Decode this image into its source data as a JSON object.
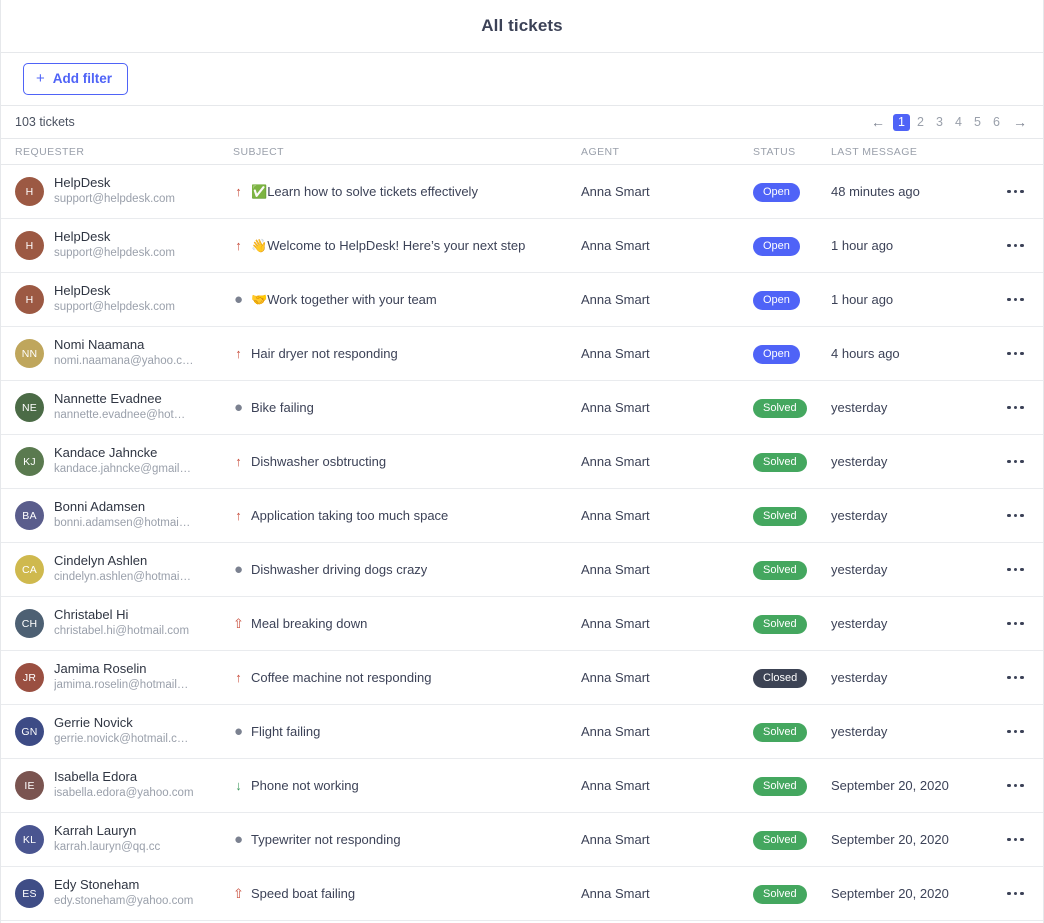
{
  "header": {
    "title": "All tickets"
  },
  "toolbar": {
    "add_filter_label": "Add filter",
    "plus_glyph": "+",
    "ticket_count": "103 tickets"
  },
  "pagination": {
    "prev_glyph": "←",
    "next_glyph": "→",
    "pages": [
      "1",
      "2",
      "3",
      "4",
      "5",
      "6"
    ],
    "active_page": "1",
    "active_color": "#4f63f7"
  },
  "columns": {
    "requester": "REQUESTER",
    "subject": "SUBJECT",
    "agent": "AGENT",
    "status": "STATUS",
    "last_message": "LAST MESSAGE"
  },
  "status_colors": {
    "Open": "#4f63f7",
    "Solved": "#44a75f",
    "Closed": "#3c4354"
  },
  "priority_glyphs": {
    "urgent": "⇧",
    "high": "↑",
    "normal": "●",
    "low": "↓"
  },
  "rows": [
    {
      "initials": "H",
      "avatar_color": "#9c5943",
      "name": "HelpDesk",
      "email": "support@helpdesk.com",
      "priority": "high",
      "emoji": "✅",
      "subject": "Learn how to solve tickets effectively",
      "agent": "Anna Smart",
      "status": "Open",
      "last_message": "48 minutes ago"
    },
    {
      "initials": "H",
      "avatar_color": "#9c5943",
      "name": "HelpDesk",
      "email": "support@helpdesk.com",
      "priority": "high",
      "emoji": "👋",
      "subject": "Welcome to HelpDesk! Here’s your next step",
      "agent": "Anna Smart",
      "status": "Open",
      "last_message": "1 hour ago"
    },
    {
      "initials": "H",
      "avatar_color": "#9c5943",
      "name": "HelpDesk",
      "email": "support@helpdesk.com",
      "priority": "normal",
      "emoji": "🤝",
      "subject": "Work together with your team",
      "agent": "Anna Smart",
      "status": "Open",
      "last_message": "1 hour ago"
    },
    {
      "initials": "NN",
      "avatar_color": "#bfa65c",
      "name": "Nomi Naamana",
      "email": "nomi.naamana@yahoo.c…",
      "priority": "high",
      "emoji": "",
      "subject": "Hair dryer not responding",
      "agent": "Anna Smart",
      "status": "Open",
      "last_message": "4 hours ago"
    },
    {
      "initials": "NE",
      "avatar_color": "#4b6b46",
      "name": "Nannette Evadnee",
      "email": "nannette.evadnee@hot…",
      "priority": "normal",
      "emoji": "",
      "subject": "Bike failing",
      "agent": "Anna Smart",
      "status": "Solved",
      "last_message": "yesterday"
    },
    {
      "initials": "KJ",
      "avatar_color": "#5a7a4f",
      "name": "Kandace Jahncke",
      "email": "kandace.jahncke@gmail…",
      "priority": "high",
      "emoji": "",
      "subject": "Dishwasher osbtructing",
      "agent": "Anna Smart",
      "status": "Solved",
      "last_message": "yesterday"
    },
    {
      "initials": "BA",
      "avatar_color": "#5a5d8c",
      "name": "Bonni Adamsen",
      "email": "bonni.adamsen@hotmai…",
      "priority": "high",
      "emoji": "",
      "subject": "Application taking too much space",
      "agent": "Anna Smart",
      "status": "Solved",
      "last_message": "yesterday"
    },
    {
      "initials": "CA",
      "avatar_color": "#cfb94e",
      "name": "Cindelyn Ashlen",
      "email": "cindelyn.ashlen@hotmai…",
      "priority": "normal",
      "emoji": "",
      "subject": "Dishwasher driving dogs crazy",
      "agent": "Anna Smart",
      "status": "Solved",
      "last_message": "yesterday"
    },
    {
      "initials": "CH",
      "avatar_color": "#4d6073",
      "name": "Christabel Hi",
      "email": "christabel.hi@hotmail.com",
      "priority": "urgent",
      "emoji": "",
      "subject": "Meal breaking down",
      "agent": "Anna Smart",
      "status": "Solved",
      "last_message": "yesterday"
    },
    {
      "initials": "JR",
      "avatar_color": "#9a4f41",
      "name": "Jamima Roselin",
      "email": "jamima.roselin@hotmail…",
      "priority": "high",
      "emoji": "",
      "subject": "Coffee machine not responding",
      "agent": "Anna Smart",
      "status": "Closed",
      "last_message": "yesterday"
    },
    {
      "initials": "GN",
      "avatar_color": "#3d4b85",
      "name": "Gerrie Novick",
      "email": "gerrie.novick@hotmail.c…",
      "priority": "normal",
      "emoji": "",
      "subject": "Flight failing",
      "agent": "Anna Smart",
      "status": "Solved",
      "last_message": "yesterday"
    },
    {
      "initials": "IE",
      "avatar_color": "#7a5450",
      "name": "Isabella Edora",
      "email": "isabella.edora@yahoo.com",
      "priority": "low",
      "emoji": "",
      "subject": "Phone not working",
      "agent": "Anna Smart",
      "status": "Solved",
      "last_message": "September 20, 2020"
    },
    {
      "initials": "KL",
      "avatar_color": "#4a5590",
      "name": "Karrah Lauryn",
      "email": "karrah.lauryn@qq.cc",
      "priority": "normal",
      "emoji": "",
      "subject": "Typewriter not responding",
      "agent": "Anna Smart",
      "status": "Solved",
      "last_message": "September 20, 2020"
    },
    {
      "initials": "ES",
      "avatar_color": "#3f4d86",
      "name": "Edy Stoneham",
      "email": "edy.stoneham@yahoo.com",
      "priority": "urgent",
      "emoji": "",
      "subject": "Speed boat failing",
      "agent": "Anna Smart",
      "status": "Solved",
      "last_message": "September 20, 2020"
    }
  ]
}
